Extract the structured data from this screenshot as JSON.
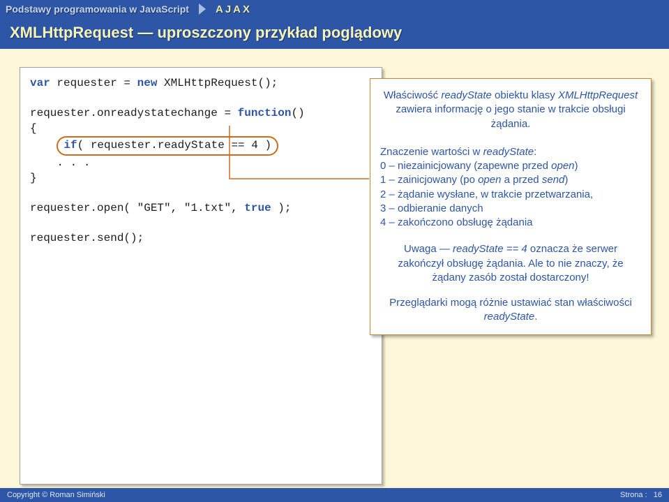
{
  "header": {
    "course_title": "Podstawy programowania w JavaScript",
    "badge": "AJAX"
  },
  "slide_title": "XMLHttpRequest — uproszczony przykład poglądowy",
  "code": {
    "line1_kw": "var",
    "line1_rest": " requester = ",
    "line1_kw2": "new",
    "line1_rest2": " XMLHttpRequest();",
    "line3": "requester.onreadystatechange = ",
    "line3_kw": "function",
    "line3_rest": "()",
    "line4": "{",
    "line5_pre": "    ",
    "line5_kw": "if",
    "line5_rest": "( requester.readyState == 4 )",
    "line6": "    . . .",
    "line7": "}",
    "line9_a": "requester.open( ",
    "line9_s1": "\"GET\"",
    "line9_b": ", ",
    "line9_s2": "\"1.txt\"",
    "line9_c": ", ",
    "line9_kw": "true",
    "line9_d": " );",
    "line11": "requester.send();"
  },
  "note": {
    "p1_a": "Właściwość ",
    "p1_em1": "readyState",
    "p1_b": " obiektu klasy ",
    "p1_em2": "XMLHttpRequest",
    "p1_c": " zawiera informację o jego stanie w trakcie obsługi żądania.",
    "p2_a": "Znaczenie wartości w ",
    "p2_em": "readyState",
    "p2_c": ":",
    "p2_l0": "0 – niezainicjowany (zapewne przed ",
    "p2_l0_em": "open",
    "p2_l0_end": ")",
    "p2_l1": "1 – zainicjowany (po ",
    "p2_l1_em1": "open",
    "p2_l1_mid": " a przed ",
    "p2_l1_em2": "send",
    "p2_l1_end": ")",
    "p2_l2": "2 – żądanie wysłane, w trakcie przetwarzania,",
    "p2_l3": "3 – odbieranie danych",
    "p2_l4": "4 – zakończono obsługę żądania",
    "p3_a": "Uwaga — ",
    "p3_em": "readyState == 4",
    "p3_b": " oznacza że serwer zakończył obsługę żądania. Ale to nie znaczy, że żądany zasób został dostarczony!",
    "p4_a": "Przeglądarki mogą różnie ustawiać stan właściwości ",
    "p4_em": "readyState",
    "p4_b": "."
  },
  "footer": {
    "left": "Copyright © Roman Simiński",
    "right_label": "Strona :",
    "right_value": "16"
  }
}
